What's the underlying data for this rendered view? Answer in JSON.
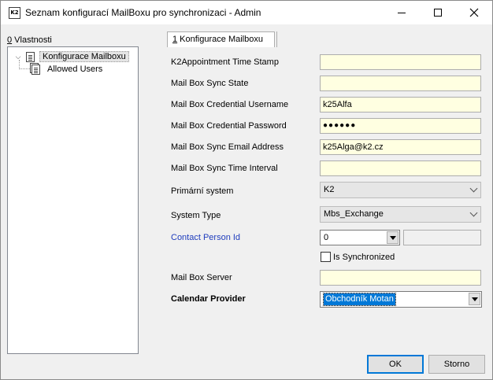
{
  "window": {
    "app_icon_text": "K2",
    "title": "Seznam konfigurací MailBoxu pro synchronizaci - Admin",
    "buttons": [
      "minimize-icon",
      "maximize-icon",
      "close-icon"
    ]
  },
  "left_panel": {
    "header_hotkey": "0",
    "header_rest": " Vlastnosti",
    "tree": [
      {
        "label": "Konfigurace Mailboxu",
        "expanded": true,
        "selected": true,
        "icon": "document-icon"
      },
      {
        "label": "Allowed Users",
        "expanded": false,
        "selected": false,
        "icon": "documents-icon"
      }
    ]
  },
  "tab": {
    "hotkey": "1",
    "label": " Konfigurace Mailboxu"
  },
  "form": {
    "appointment_ts_label": "K2Appointment Time Stamp",
    "appointment_ts_value": "",
    "sync_state_label": "Mail Box Sync State",
    "sync_state_value": "",
    "username_label": "Mail Box Credential Username",
    "username_value": "k25Alfa",
    "password_label": "Mail Box Credential Password",
    "password_value": "●●●●●●",
    "email_label": "Mail Box Sync Email Address",
    "email_value": "k25Alga@k2.cz",
    "interval_label": "Mail Box Sync Time Interval",
    "interval_value": "",
    "primary_system_label": "Primární system",
    "primary_system_value": "K2",
    "system_type_label": "System Type",
    "system_type_value": "Mbs_Exchange",
    "contact_person_label": "Contact Person Id",
    "contact_person_value": "0",
    "contact_person_extra": "",
    "is_synchronized_label": "Is Synchronized",
    "is_synchronized_checked": false,
    "server_label": "Mail Box Server",
    "server_value": "",
    "calendar_provider_label": "Calendar Provider",
    "calendar_provider_value": "Obchodník Motan"
  },
  "buttons": {
    "ok": "OK",
    "cancel": "Storno"
  },
  "colors": {
    "input_bg": "#ffffe1",
    "link": "#1f3dbd",
    "selection": "#0078d7"
  }
}
